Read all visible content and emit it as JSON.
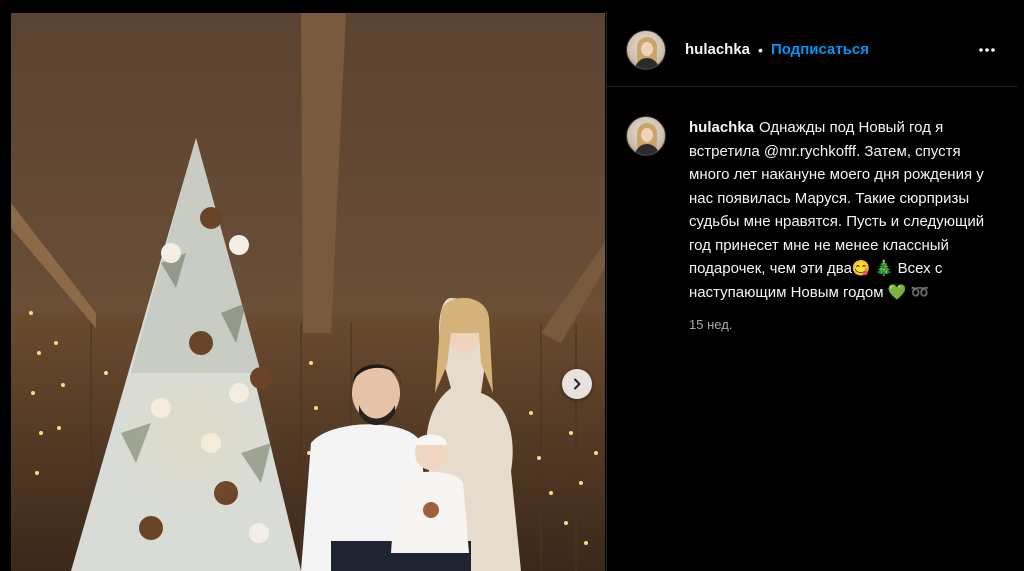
{
  "post": {
    "username": "hulachka",
    "separator": "•",
    "follow_label": "Подписаться",
    "more_icon": "more-horizontal-icon",
    "caption": {
      "username": "hulachka",
      "text": "Однажды под Новый год я встретила @mr.rychkofff. Затем, спустя много лет накануне моего дня рождения у нас появилась Маруся. Такие сюрпризы судьбы мне нравятся. Пусть и следующий год принесет мне не менее классный подарочек, чем эти два",
      "emoji_1": "😋",
      "emoji_2": "🎄",
      "text_tail": " Всех с наступающим Новым годом ",
      "emoji_3": "💚",
      "emoji_4": "➿"
    },
    "timestamp": "15 нед."
  },
  "photo": {
    "next_icon": "chevron-right-icon"
  }
}
